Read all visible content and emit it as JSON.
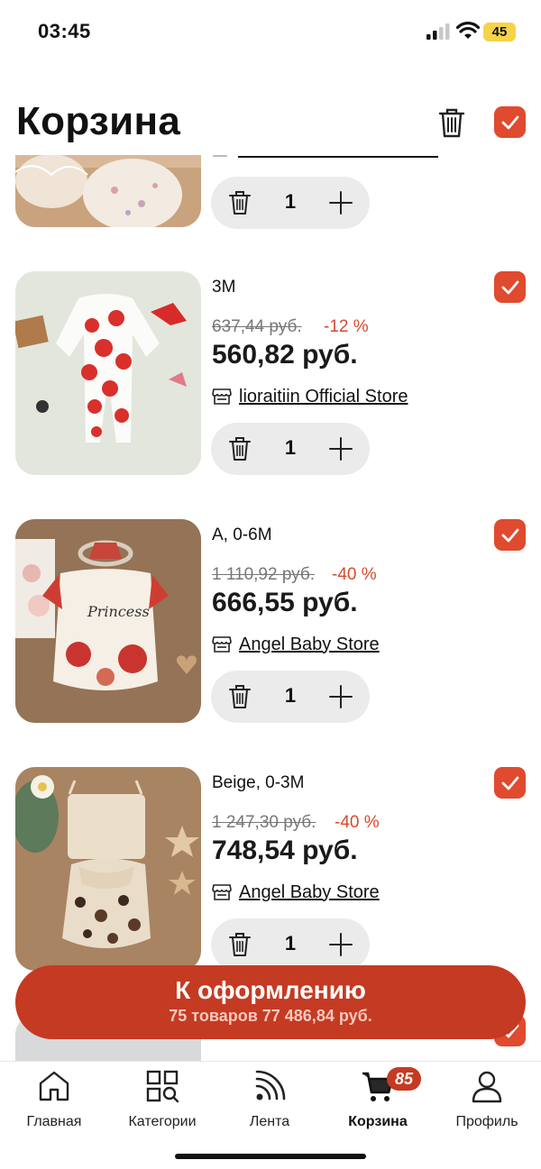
{
  "status_bar": {
    "time": "03:45",
    "battery": "45"
  },
  "header": {
    "title": "Корзина"
  },
  "items": [
    {
      "variant": "",
      "old_price": "",
      "discount": "",
      "price": "",
      "store": "",
      "qty": "1"
    },
    {
      "variant": "3M",
      "old_price": "637,44 руб.",
      "discount": "-12 %",
      "price": "560,82 руб.",
      "store": "lioraitiin Official Store",
      "qty": "1"
    },
    {
      "variant": "A, 0-6M",
      "old_price": "1 110,92 руб.",
      "discount": "-40 %",
      "price": "666,55 руб.",
      "store": "Angel Baby Store",
      "qty": "1"
    },
    {
      "variant": "Beige, 0-3M",
      "old_price": "1 247,30 руб.",
      "discount": "-40 %",
      "price": "748,54 руб.",
      "store": "Angel Baby Store",
      "qty": "1"
    }
  ],
  "checkout": {
    "label": "К оформлению",
    "summary": "75 товаров  77 486,84 руб."
  },
  "tabbar": {
    "items": [
      {
        "label": "Главная",
        "icon": "home-icon"
      },
      {
        "label": "Категории",
        "icon": "categories-icon"
      },
      {
        "label": "Лента",
        "icon": "feed-icon"
      },
      {
        "label": "Корзина",
        "icon": "cart-icon",
        "badge": "85"
      },
      {
        "label": "Профиль",
        "icon": "profile-icon"
      }
    ]
  },
  "colors": {
    "accent": "#e04a2e",
    "checkout": "#c53a22",
    "discount": "#d64a2d"
  }
}
